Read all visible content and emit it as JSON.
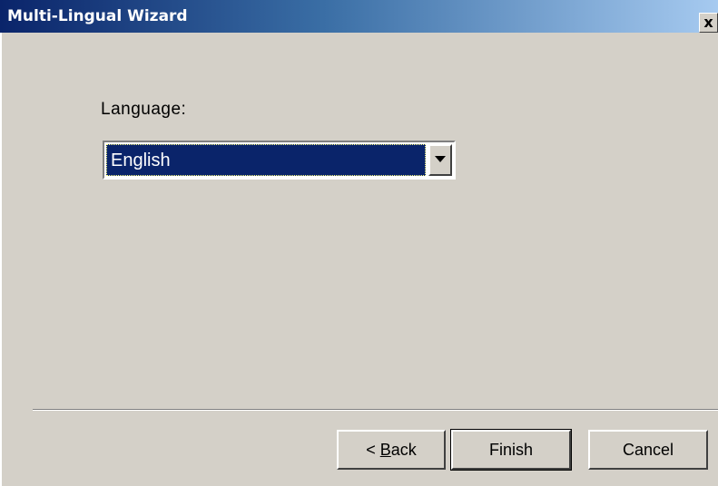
{
  "window": {
    "title": "Multi-Lingual Wizard",
    "close_glyph": "x"
  },
  "form": {
    "language_label": "Language:",
    "language_selected": "English"
  },
  "buttons": {
    "back_prefix": "< ",
    "back_mnemonic": "B",
    "back_rest": "ack",
    "finish": "Finish",
    "cancel": "Cancel"
  },
  "icons": {
    "close": "close-icon",
    "dropdown": "chevron-down-icon"
  },
  "colors": {
    "window_bg": "#d4d0c8",
    "titlebar_start": "#0a246a",
    "titlebar_end": "#a6caf0",
    "selection_bg": "#0a246a"
  }
}
